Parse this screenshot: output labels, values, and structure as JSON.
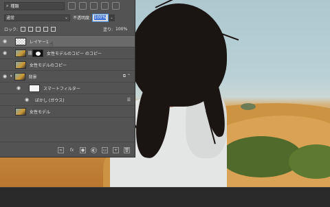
{
  "panel": {
    "filter_label": "種類",
    "blend_mode": "通常",
    "opacity_label": "不透明度:",
    "opacity_value": "100%",
    "lock_label": "ロック:",
    "fill_label": "塗り:",
    "fill_value": "100%"
  },
  "layers": [
    {
      "name": "レイヤー1",
      "visible": true,
      "selected": true
    },
    {
      "name": "女性モデルのコピー のコピー",
      "visible": true,
      "selected": false
    },
    {
      "name": "女性モデルのコピー",
      "visible": false,
      "selected": false
    },
    {
      "name": "背景",
      "visible": true,
      "selected": false
    },
    {
      "name": "スマートフィルター",
      "visible": true,
      "selected": false
    },
    {
      "name": "ぼかし (ガウス)",
      "visible": true,
      "selected": false
    },
    {
      "name": "女性モデル",
      "visible": false,
      "selected": false
    }
  ],
  "bottom_icons": [
    "link-icon",
    "fx-icon",
    "mask-icon",
    "adjustment-icon",
    "group-icon",
    "new-layer-icon",
    "trash-icon"
  ],
  "colors": {
    "panel_bg": "#535353",
    "selection": "#6a6a6a",
    "accent": "#3b6fd6"
  }
}
